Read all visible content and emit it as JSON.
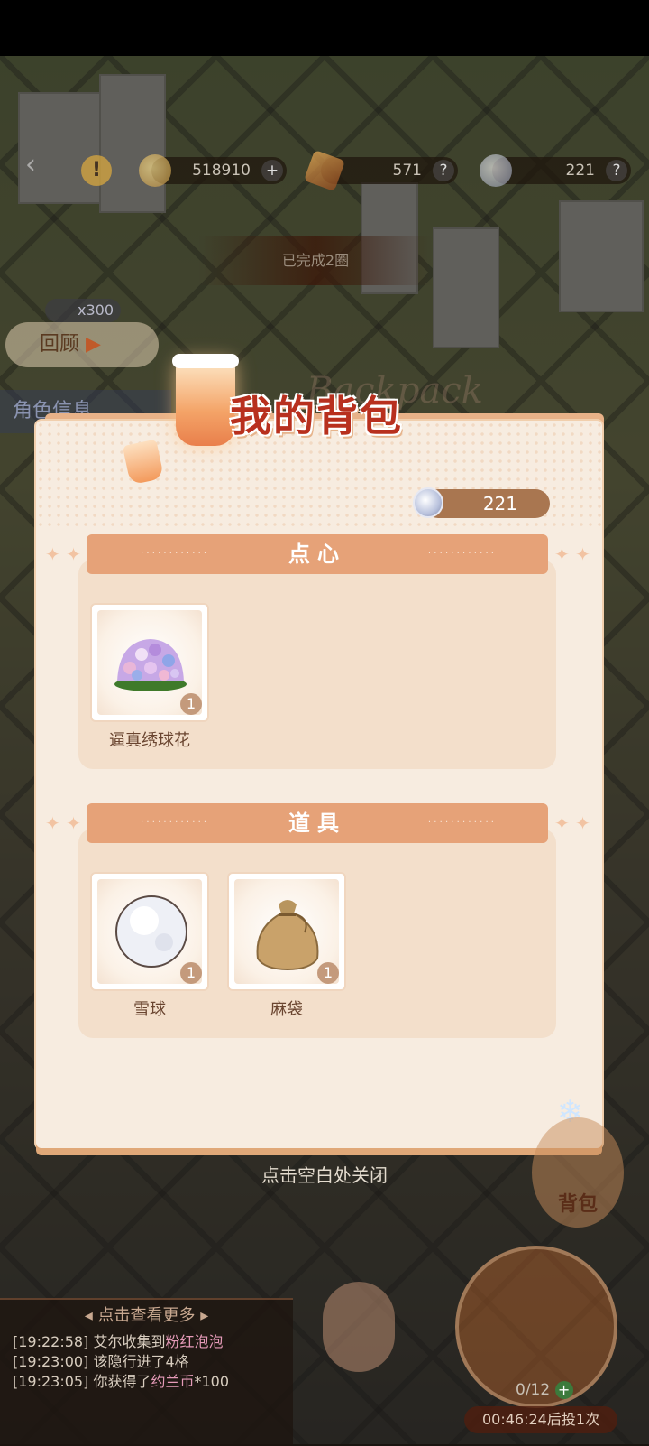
{
  "hud": {
    "gold": "518910",
    "gem": "571",
    "silver": "221",
    "banner": "已完成2圈",
    "ticket": "x300",
    "review_label": "回顾",
    "role_label": "角色信息"
  },
  "backpack": {
    "title": "我的背包",
    "title_en": "Backpack",
    "silver_balance": "221",
    "sections": [
      {
        "label": "点心",
        "items": [
          {
            "name": "逼真绣球花",
            "count": "1",
            "icon": "hydrangea-icon"
          }
        ]
      },
      {
        "label": "道具",
        "items": [
          {
            "name": "雪球",
            "count": "1",
            "icon": "snowball-icon"
          },
          {
            "name": "麻袋",
            "count": "1",
            "icon": "sack-icon"
          }
        ]
      }
    ],
    "close_hint": "点击空白处关闭"
  },
  "bottom": {
    "bag_button": "背包",
    "log_header": "点击查看更多",
    "log": [
      {
        "time": "[19:22:58]",
        "text": "艾尔收集到",
        "highlight": "粉红泡泡",
        "tail": ""
      },
      {
        "time": "[19:23:00]",
        "text": "该隐行进了4格",
        "highlight": "",
        "tail": ""
      },
      {
        "time": "[19:23:05]",
        "text": "你获得了",
        "highlight": "约兰币",
        "tail": "*100"
      }
    ],
    "dice_count": "0/12",
    "timer": "00:46:24后投1次"
  },
  "colors": {
    "accent": "#e6a278",
    "title": "#b8301e",
    "panel": "#f7ece0"
  }
}
